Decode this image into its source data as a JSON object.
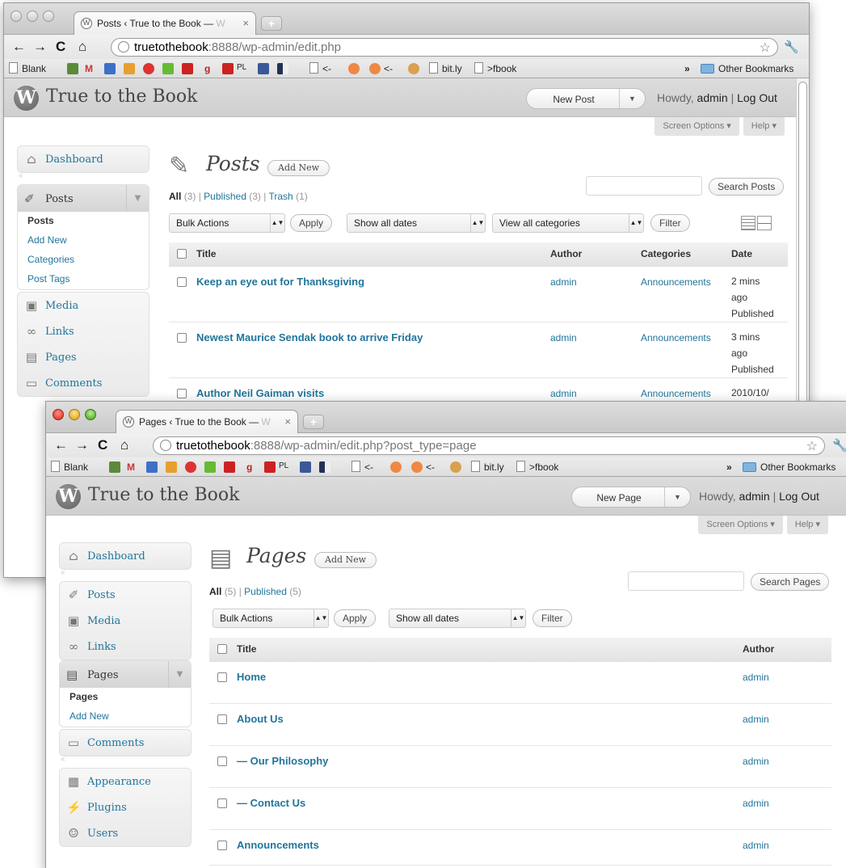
{
  "win1": {
    "tab": {
      "title": "Posts ‹ True to the Book — ",
      "fade": "W",
      "close": "×"
    },
    "url": {
      "host": "truetothebook",
      "rest": ":8888/wp-admin/edit.php"
    },
    "bookmarks": {
      "blank": "Blank",
      "pl": "PL",
      "arrow1": "<-",
      "arrow2": "<-",
      "bitly": "bit.ly",
      "fbook": ">fbook",
      "more": "»",
      "other": "Other Bookmarks"
    },
    "header": {
      "site_title": "True to the Book",
      "fav_action": "New Post",
      "howdy": "Howdy,",
      "user": "admin",
      "sep": "|",
      "logout": "Log Out"
    },
    "screen_options": "Screen Options ▾",
    "help": "Help ▾",
    "menu": {
      "dashboard": "Dashboard",
      "posts": "Posts",
      "sub": [
        "Posts",
        "Add New",
        "Categories",
        "Post Tags"
      ],
      "media": "Media",
      "links": "Links",
      "pages": "Pages",
      "comments": "Comments"
    },
    "page_title": "Posts",
    "add_new": "Add New",
    "filters": {
      "all": "All",
      "all_count": "(3)",
      "published": "Published",
      "published_count": "(3)",
      "trash": "Trash",
      "trash_count": "(1)",
      "sep": "|"
    },
    "search_button": "Search Posts",
    "bulk_actions": "Bulk Actions",
    "apply": "Apply",
    "dates": "Show all dates",
    "categories": "View all categories",
    "filter": "Filter",
    "columns": {
      "title": "Title",
      "author": "Author",
      "categories": "Categories",
      "date": "Date"
    },
    "posts": [
      {
        "title": "Keep an eye out for Thanksgiving",
        "author": "admin",
        "category": "Announcements",
        "date1": "2 mins",
        "date2": "ago",
        "date3": "Published"
      },
      {
        "title": "Newest Maurice Sendak book to arrive Friday",
        "author": "admin",
        "category": "Announcements",
        "date1": "3 mins",
        "date2": "ago",
        "date3": "Published"
      },
      {
        "title": "Author Neil Gaiman visits",
        "author": "admin",
        "category": "Announcements",
        "date1": "2010/10/",
        "date2": "",
        "date3": ""
      }
    ]
  },
  "win2": {
    "tab": {
      "title": "Pages ‹ True to the Book — ",
      "fade": "W",
      "close": "×"
    },
    "url": {
      "host": "truetothebook",
      "rest": ":8888/wp-admin/edit.php?post_type=page"
    },
    "bookmarks": {
      "blank": "Blank",
      "pl": "PL",
      "arrow1": "<-",
      "arrow2": "<-",
      "bitly": "bit.ly",
      "fbook": ">fbook",
      "more": "»",
      "other": "Other Bookmarks"
    },
    "header": {
      "site_title": "True to the Book",
      "fav_action": "New Page",
      "howdy": "Howdy,",
      "user": "admin",
      "sep": "|",
      "logout": "Log Out"
    },
    "screen_options": "Screen Options ▾",
    "help": "Help ▾",
    "menu": {
      "dashboard": "Dashboard",
      "posts": "Posts",
      "media": "Media",
      "links": "Links",
      "pages": "Pages",
      "sub": [
        "Pages",
        "Add New"
      ],
      "comments": "Comments",
      "appearance": "Appearance",
      "plugins": "Plugins",
      "users": "Users"
    },
    "page_title": "Pages",
    "add_new": "Add New",
    "filters": {
      "all": "All",
      "all_count": "(5)",
      "published": "Published",
      "published_count": "(5)",
      "sep": "|"
    },
    "search_button": "Search Pages",
    "bulk_actions": "Bulk Actions",
    "apply": "Apply",
    "dates": "Show all dates",
    "filter": "Filter",
    "columns": {
      "title": "Title",
      "author": "Author"
    },
    "pages": [
      {
        "title": "Home",
        "author": "admin"
      },
      {
        "title": "About Us",
        "author": "admin"
      },
      {
        "title": "— Our Philosophy",
        "author": "admin"
      },
      {
        "title": "— Contact Us",
        "author": "admin"
      },
      {
        "title": "Announcements",
        "author": "admin"
      }
    ]
  },
  "colors": {
    "link": "#21759b",
    "header_bg": "#d5d5d5"
  }
}
